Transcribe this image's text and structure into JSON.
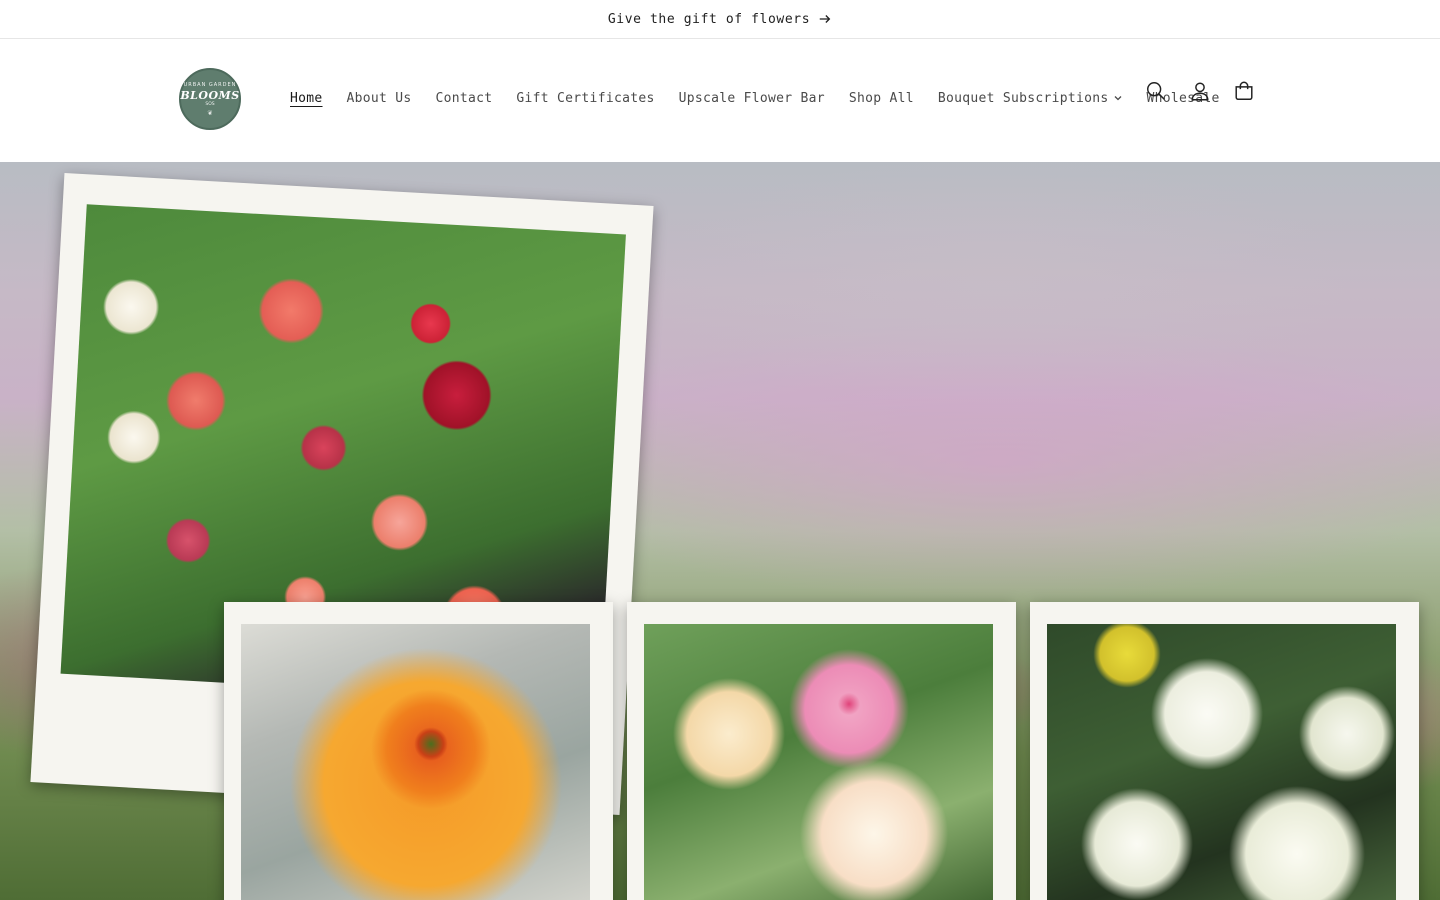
{
  "announcement": {
    "text": "Give the gift of flowers"
  },
  "logo": {
    "arc": "URBAN GARDEN",
    "main": "BLOOMS",
    "sub": "SOS"
  },
  "nav": {
    "items": [
      {
        "label": "Home",
        "active": true
      },
      {
        "label": "About Us"
      },
      {
        "label": "Contact"
      },
      {
        "label": "Gift Certificates"
      },
      {
        "label": "Upscale Flower Bar"
      },
      {
        "label": "Shop All"
      },
      {
        "label": "Bouquet Subscriptions",
        "dropdown": true
      },
      {
        "label": "Wholesale"
      }
    ]
  },
  "header_icons": [
    "search-icon",
    "account-icon",
    "cart-icon"
  ],
  "hero": {
    "images": [
      "strawflowers-photo",
      "orange-dahlia-photo",
      "pink-cream-dahlias-photo",
      "white-lisianthus-photo"
    ]
  },
  "colors": {
    "logo_green": "#5f7d6e",
    "text": "#333333",
    "border": "#e6e6e6"
  }
}
